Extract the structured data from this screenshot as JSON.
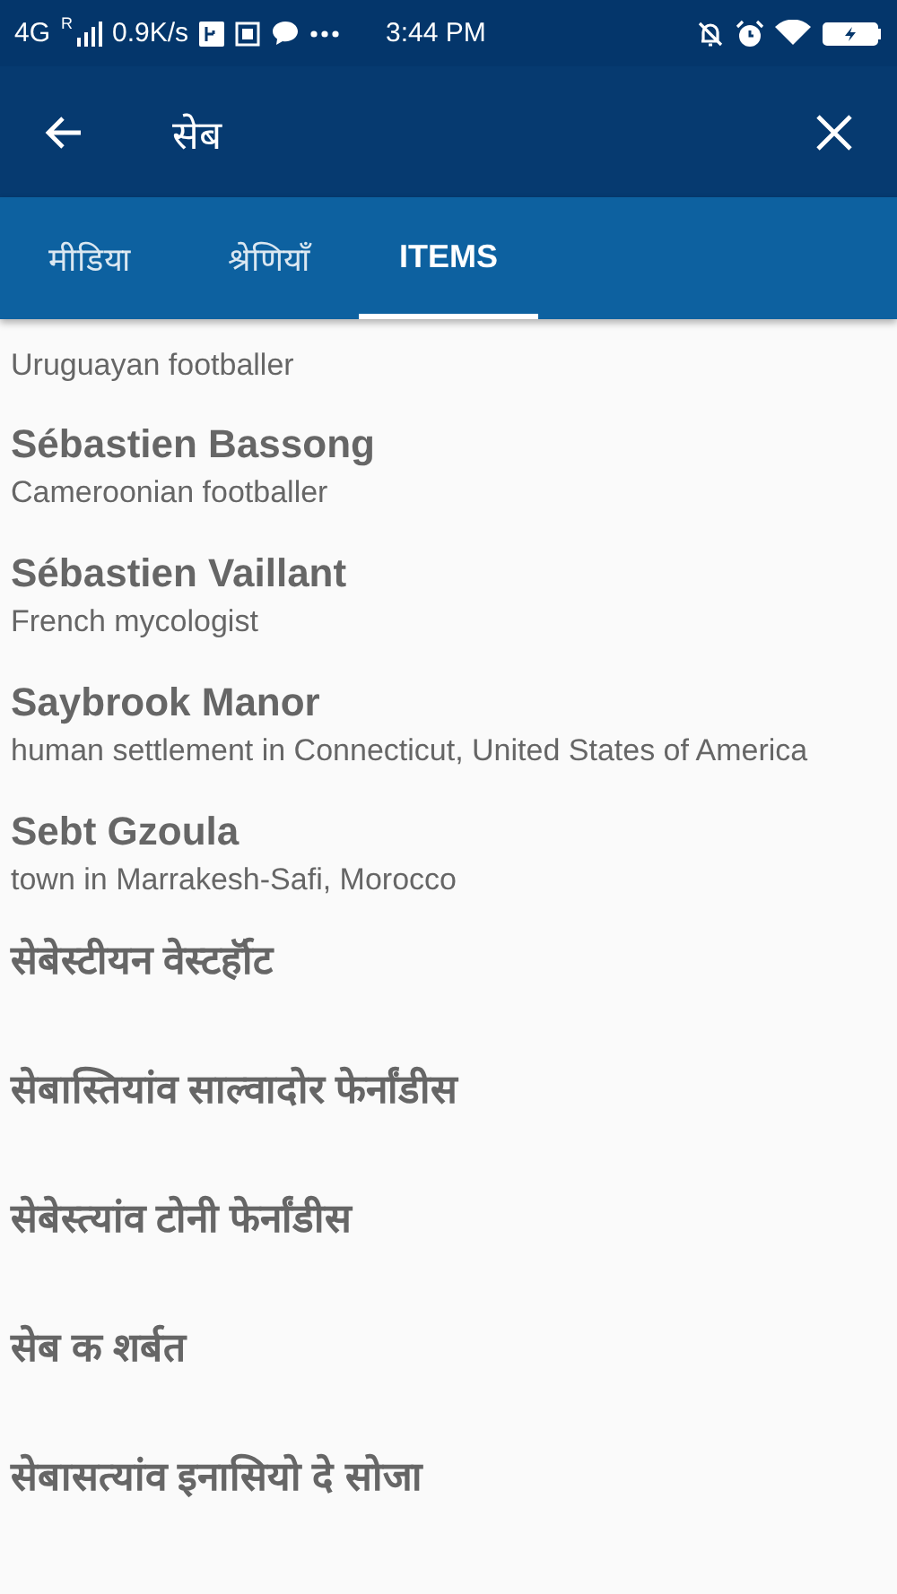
{
  "status_bar": {
    "network": "4G",
    "roaming": "R",
    "speed": "0.9K/s",
    "time": "3:44 PM"
  },
  "search": {
    "value": "सेब"
  },
  "tabs": [
    {
      "label": "मीडिया",
      "selected": false
    },
    {
      "label": "श्रेणियाँ",
      "selected": false
    },
    {
      "label": "ITEMS",
      "selected": true
    }
  ],
  "results": [
    {
      "description": "Uruguayan footballer"
    },
    {
      "title": "Sébastien Bassong",
      "description": "Cameroonian footballer"
    },
    {
      "title": "Sébastien Vaillant",
      "description": "French mycologist"
    },
    {
      "title": "Saybrook Manor",
      "description": "human settlement in Connecticut, United States of America"
    },
    {
      "title": "Sebt Gzoula",
      "description": "town in Marrakesh-Safi, Morocco"
    },
    {
      "title": "सेबेस्टीयन वेस्टर्हॉट"
    },
    {
      "title": "सेबास्तियांव साल्वादोर फेर्नांडीस"
    },
    {
      "title": "सेबेस्त्यांव टोनी फेर्नांडीस"
    },
    {
      "title": "सेब क शर्बत"
    },
    {
      "title": "सेबासत्यांव इनासियो दे सोजा"
    }
  ]
}
